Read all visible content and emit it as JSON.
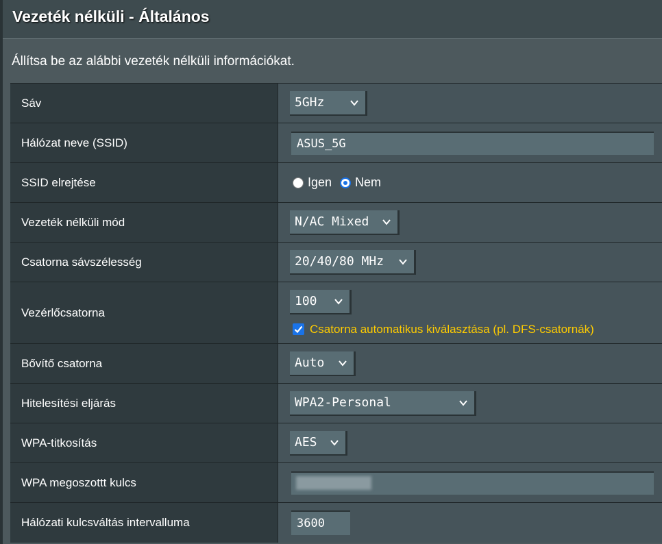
{
  "header": {
    "title": "Vezeték nélküli - Általános"
  },
  "description": "Állítsa be az alábbi vezeték nélküli információkat.",
  "rows": {
    "band": {
      "label": "Sáv",
      "value": "5GHz"
    },
    "ssid": {
      "label": "Hálózat neve (SSID)",
      "value": "ASUS_5G"
    },
    "hide_ssid": {
      "label": "SSID elrejtése",
      "option_yes": "Igen",
      "option_no": "Nem",
      "selected": "Nem"
    },
    "wireless_mode": {
      "label": "Vezeték nélküli mód",
      "value": "N/AC Mixed"
    },
    "bandwidth": {
      "label": "Csatorna sávszélesség",
      "value": "20/40/80 MHz"
    },
    "control_channel": {
      "label": "Vezérlőcsatorna",
      "value": "100",
      "auto_label": "Csatorna automatikus kiválasztása (pl. DFS-csatornák)",
      "auto_checked": true
    },
    "extension_channel": {
      "label": "Bővítő csatorna",
      "value": "Auto"
    },
    "auth_method": {
      "label": "Hitelesítési eljárás",
      "value": "WPA2-Personal"
    },
    "wpa_encryption": {
      "label": "WPA-titkosítás",
      "value": "AES"
    },
    "wpa_key": {
      "label": "WPA megoszottt kulcs",
      "value": ""
    },
    "key_rotation": {
      "label": "Hálózati kulcsváltás intervalluma",
      "value": "3600"
    }
  },
  "colors": {
    "background": "#4d595d",
    "label_cell": "#2f3a3e",
    "value_cell": "#46545a",
    "accent": "#1a73e8",
    "highlight_text": "#ffcc00"
  }
}
